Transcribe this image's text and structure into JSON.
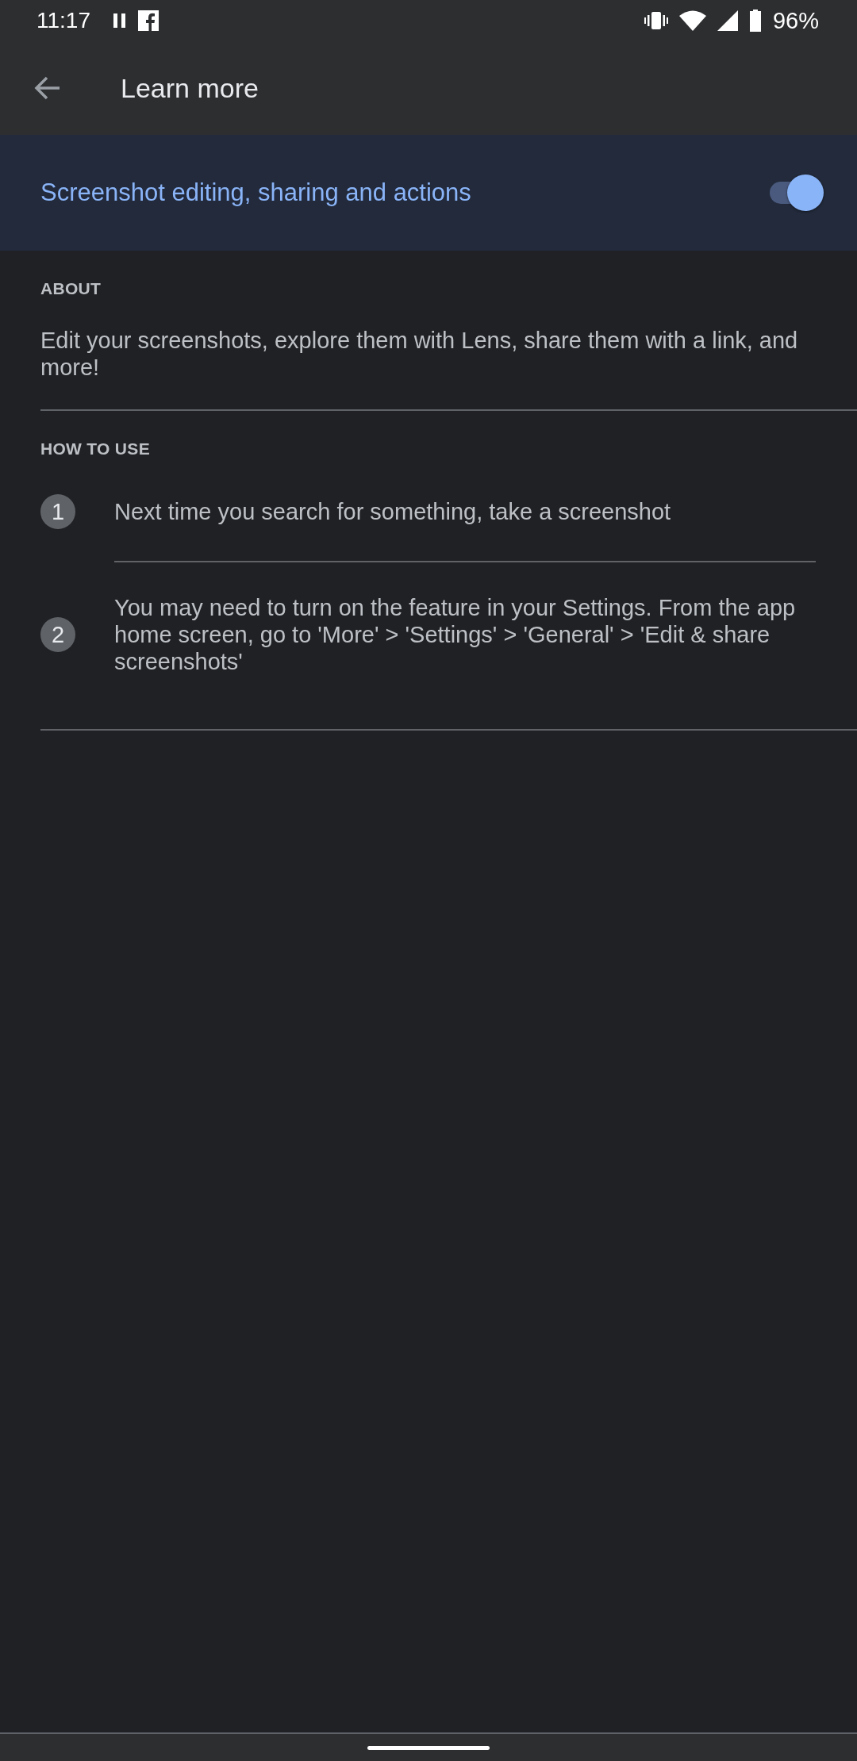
{
  "status_bar": {
    "time": "11:17",
    "battery": "96%"
  },
  "app_bar": {
    "title": "Learn more"
  },
  "feature": {
    "label": "Screenshot editing, sharing and actions",
    "on": true
  },
  "about": {
    "heading": "ABOUT",
    "text": "Edit your screenshots, explore them with Lens, share them with a link, and more!"
  },
  "how_to_use": {
    "heading": "HOW TO USE",
    "steps": [
      {
        "number": "1",
        "text": "Next time you search for something, take a screenshot"
      },
      {
        "number": "2",
        "text": "You may need to turn on the feature in your Settings. From the app home screen, go to 'More' > 'Settings' > 'General' > 'Edit & share screenshots'"
      }
    ]
  }
}
